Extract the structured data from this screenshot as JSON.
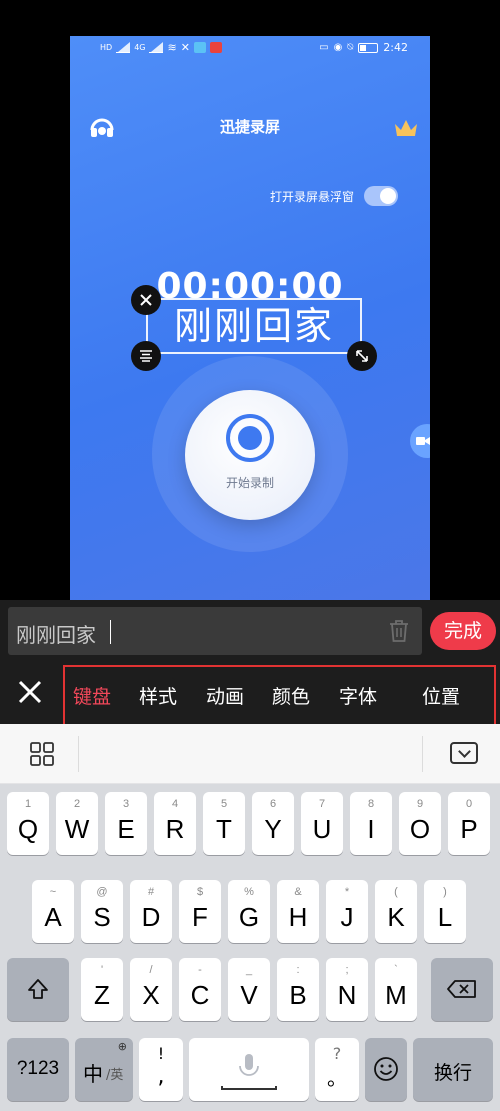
{
  "status_bar": {
    "left_labels": [
      "HD",
      "4G",
      "HD",
      "4G"
    ],
    "time": "2:42"
  },
  "app": {
    "title": "迅捷录屏",
    "float_window_label": "打开录屏悬浮窗",
    "float_window_on": true,
    "timer": "00:00:00",
    "caption_text": "刚刚回家",
    "record_label": "开始录制"
  },
  "editor": {
    "input_value": "刚刚回家",
    "done_label": "完成",
    "tabs": [
      {
        "label": "键盘",
        "active": true
      },
      {
        "label": "样式",
        "active": false
      },
      {
        "label": "动画",
        "active": false
      },
      {
        "label": "颜色",
        "active": false
      },
      {
        "label": "字体",
        "active": false
      },
      {
        "label": "位置",
        "active": false
      }
    ]
  },
  "keyboard": {
    "row1": [
      {
        "main": "Q",
        "sub": "1"
      },
      {
        "main": "W",
        "sub": "2"
      },
      {
        "main": "E",
        "sub": "3"
      },
      {
        "main": "R",
        "sub": "4"
      },
      {
        "main": "T",
        "sub": "5"
      },
      {
        "main": "Y",
        "sub": "6"
      },
      {
        "main": "U",
        "sub": "7"
      },
      {
        "main": "I",
        "sub": "8"
      },
      {
        "main": "O",
        "sub": "9"
      },
      {
        "main": "P",
        "sub": "0"
      }
    ],
    "row2": [
      {
        "main": "A",
        "sub": "~"
      },
      {
        "main": "S",
        "sub": "@"
      },
      {
        "main": "D",
        "sub": "#"
      },
      {
        "main": "F",
        "sub": "$"
      },
      {
        "main": "G",
        "sub": "%"
      },
      {
        "main": "H",
        "sub": "&"
      },
      {
        "main": "J",
        "sub": "*"
      },
      {
        "main": "K",
        "sub": "("
      },
      {
        "main": "L",
        "sub": ")"
      }
    ],
    "row3": [
      {
        "main": "Z",
        "sub": "'"
      },
      {
        "main": "X",
        "sub": "/"
      },
      {
        "main": "C",
        "sub": "-"
      },
      {
        "main": "V",
        "sub": "_"
      },
      {
        "main": "B",
        "sub": ":"
      },
      {
        "main": "N",
        "sub": ";"
      },
      {
        "main": "M",
        "sub": "`"
      }
    ],
    "num_key": "?123",
    "lang_key_main": "中",
    "lang_key_alt": "/英",
    "punct_key_top": "!",
    "punct_key_bottom": ",",
    "punct2_key_top": "?",
    "punct2_key_bottom": "。",
    "enter_key": "换行"
  },
  "colors": {
    "accent_red": "#ef3b4a",
    "active_tab": "#f2485a",
    "app_blue": "#3e79f0"
  }
}
